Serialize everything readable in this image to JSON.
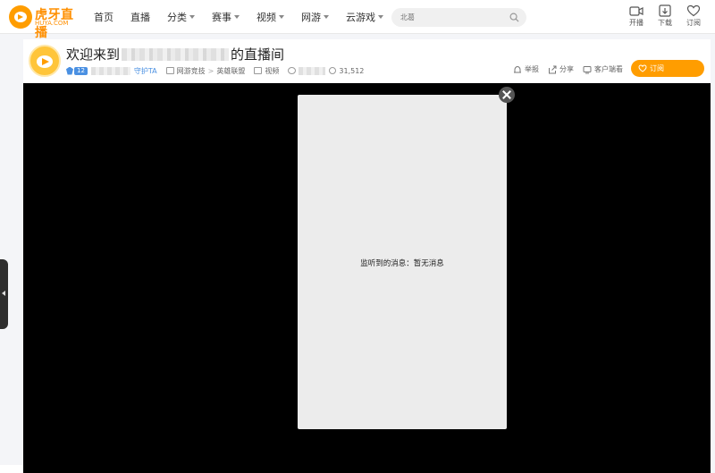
{
  "logo": {
    "text": "虎牙直播",
    "sub": "HUYA.COM"
  },
  "nav": [
    {
      "label": "首页",
      "dropdown": false
    },
    {
      "label": "直播",
      "dropdown": false
    },
    {
      "label": "分类",
      "dropdown": true
    },
    {
      "label": "赛事",
      "dropdown": true
    },
    {
      "label": "视频",
      "dropdown": true
    },
    {
      "label": "网游",
      "dropdown": true
    },
    {
      "label": "云游戏",
      "dropdown": true
    }
  ],
  "search": {
    "value": "",
    "placeholder": "北葛"
  },
  "top_buttons": [
    {
      "label": "开播",
      "icon": "camera-icon"
    },
    {
      "label": "下载",
      "icon": "download-icon"
    },
    {
      "label": "订阅",
      "icon": "heart-icon"
    }
  ],
  "room": {
    "title_prefix": "欢迎来到",
    "title_suffix": "的直播间",
    "level": "12",
    "guard": "守护TA",
    "category_main": "网游竞技",
    "category_sub": "英雄联盟",
    "video_label": "视频",
    "viewers": "31,512",
    "actions": {
      "report": "举报",
      "share": "分享",
      "client": "客户端看"
    },
    "subscribe": "订阅"
  },
  "modal": {
    "message": "监听到的消息：暂无消息"
  },
  "colors": {
    "brand": "#ff9d00",
    "link_blue": "#4a90e2",
    "player_bg": "#000000",
    "modal_bg": "#ececec"
  }
}
